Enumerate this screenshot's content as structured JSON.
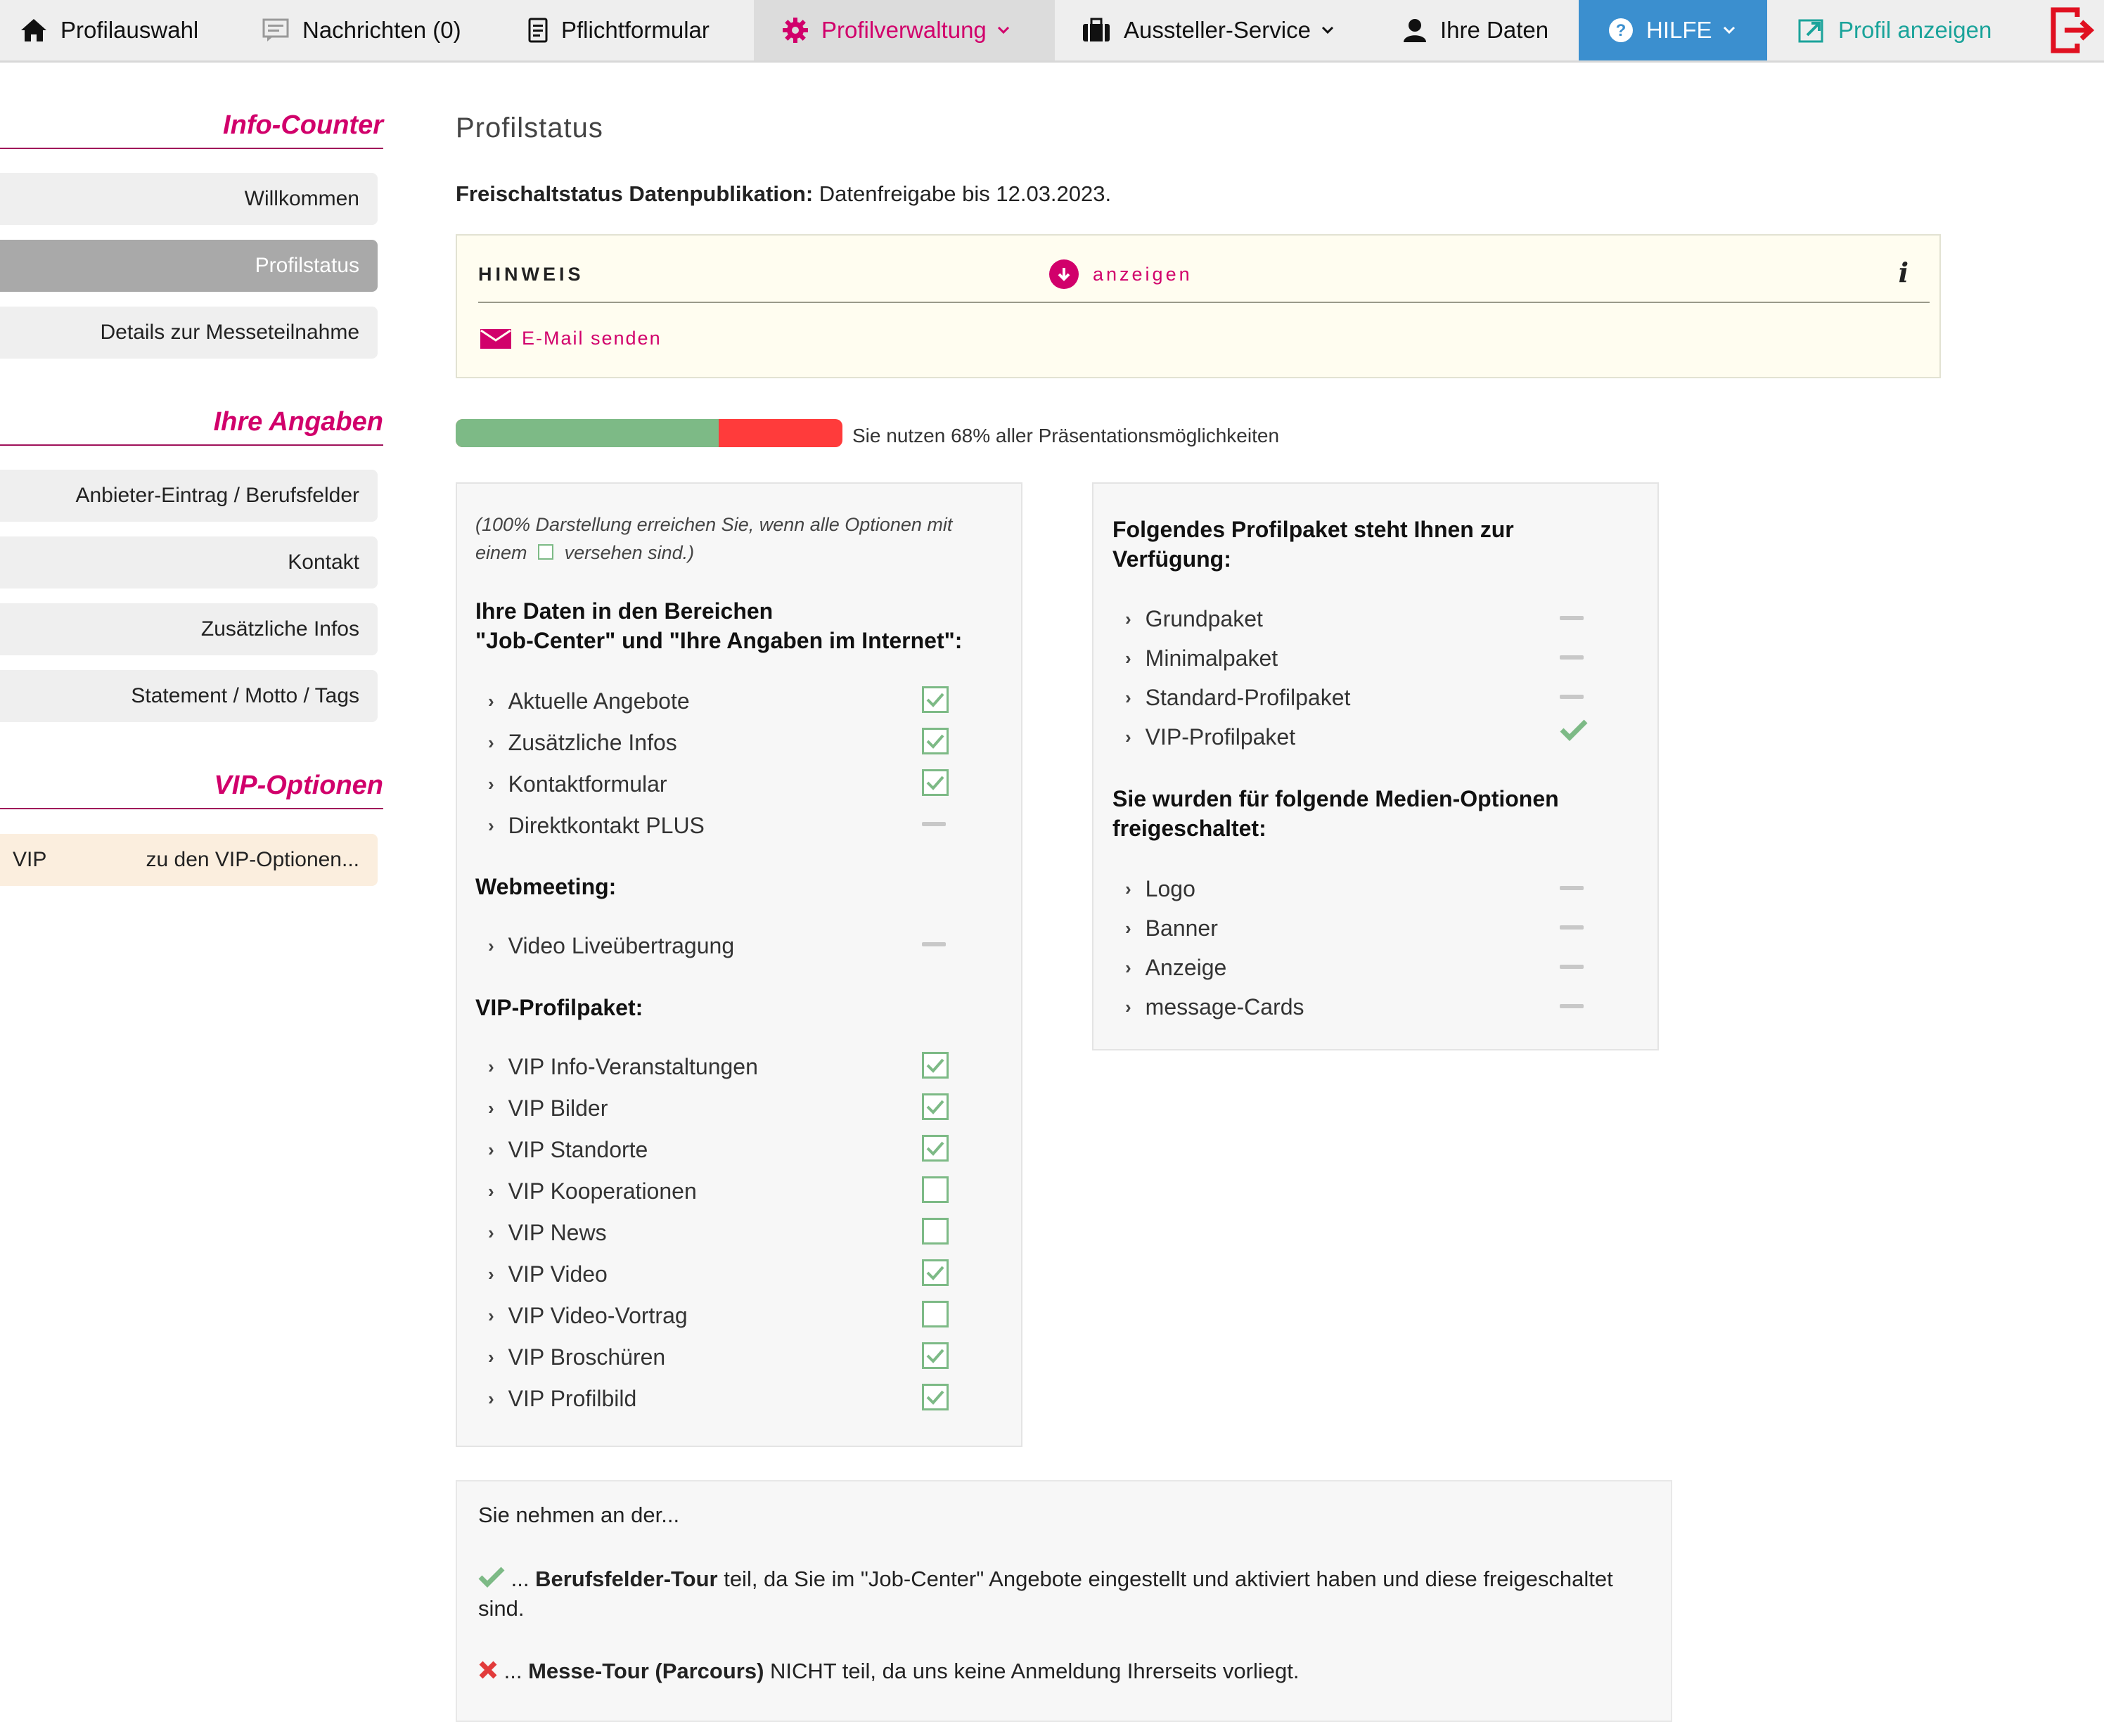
{
  "nav": {
    "profilauswahl": "Profilauswahl",
    "nachrichten": "Nachrichten (0)",
    "pflichtformular": "Pflichtformular",
    "profilverwaltung": "Profilverwaltung",
    "aussteller_service": "Aussteller-Service",
    "ihre_daten": "Ihre Daten",
    "hilfe": "HILFE",
    "profil_anzeigen": "Profil anzeigen"
  },
  "sidebar": {
    "sections": [
      {
        "title": "Info-Counter",
        "items": [
          "Willkommen",
          "Profilstatus",
          "Details zur Messeteilnahme"
        ]
      },
      {
        "title": "Ihre Angaben",
        "items": [
          "Anbieter-Eintrag / Berufsfelder",
          "Kontakt",
          "Zusätzliche Infos",
          "Statement / Motto / Tags"
        ]
      },
      {
        "title": "VIP-Optionen",
        "items": []
      }
    ],
    "vip_tag": "VIP",
    "vip_link": "zu den VIP-Optionen..."
  },
  "main": {
    "title": "Profilstatus",
    "status_label": "Freischaltstatus Datenpublikation:",
    "status_value": " Datenfreigabe bis 12.03.2023.",
    "hinweis": {
      "title": "HINWEIS",
      "show": "anzeigen",
      "info": "i",
      "mail": "E-Mail senden"
    },
    "progress": {
      "percent": 68,
      "text": "Sie nutzen 68% aller Präsentationsmöglichkeiten"
    }
  },
  "left_panel": {
    "note_before": "(100% Darstellung erreichen Sie, wenn alle Optionen mit einem",
    "note_after": "versehen sind.)",
    "section1_title_line1": "Ihre Daten in den Bereichen",
    "section1_title_line2": "\"Job-Center\" und \"Ihre Angaben im Internet\":",
    "section1": [
      {
        "label": "Aktuelle Angebote",
        "status": "checked"
      },
      {
        "label": "Zusätzliche Infos",
        "status": "checked"
      },
      {
        "label": "Kontaktformular",
        "status": "checked"
      },
      {
        "label": "Direktkontakt PLUS",
        "status": "none"
      }
    ],
    "section2_title": "Webmeeting:",
    "section2": [
      {
        "label": "Video Liveübertragung",
        "status": "none"
      }
    ],
    "section3_title": "VIP-Profilpaket:",
    "section3": [
      {
        "label": "VIP Info-Veranstaltungen",
        "status": "checked"
      },
      {
        "label": "VIP Bilder",
        "status": "checked"
      },
      {
        "label": "VIP Standorte",
        "status": "checked"
      },
      {
        "label": "VIP Kooperationen",
        "status": "unchecked"
      },
      {
        "label": "VIP News",
        "status": "unchecked"
      },
      {
        "label": "VIP Video",
        "status": "checked"
      },
      {
        "label": "VIP Video-Vortrag",
        "status": "unchecked"
      },
      {
        "label": "VIP Broschüren",
        "status": "checked"
      },
      {
        "label": "VIP Profilbild",
        "status": "checked"
      }
    ]
  },
  "right_panel": {
    "title_line1": "Folgendes Profilpaket steht Ihnen zur",
    "title_line2": "Verfügung:",
    "pakete": [
      {
        "label": "Grundpaket",
        "status": "none"
      },
      {
        "label": "Minimalpaket",
        "status": "none"
      },
      {
        "label": "Standard-Profilpaket",
        "status": "none"
      },
      {
        "label": "VIP-Profilpaket",
        "status": "tick"
      }
    ],
    "media_title_line1": "Sie wurden für folgende Medien-Optionen",
    "media_title_line2": "freigeschaltet:",
    "media": [
      {
        "label": "Logo",
        "status": "none"
      },
      {
        "label": "Banner",
        "status": "none"
      },
      {
        "label": "Anzeige",
        "status": "none"
      },
      {
        "label": "message-Cards",
        "status": "none"
      }
    ]
  },
  "tour": {
    "title": "Sie nehmen an der...",
    "line1_prefix": " ... ",
    "line1_bold": "Berufsfelder-Tour",
    "line1_rest": " teil, da Sie im \"Job-Center\" Angebote eingestellt und aktiviert haben und diese freigeschaltet sind.",
    "line2_prefix": " ... ",
    "line2_bold": "Messe-Tour (Parcours)",
    "line2_rest": " NICHT teil, da uns keine Anmeldung Ihrerseits vorliegt."
  },
  "colors": {
    "accent": "#d1006b",
    "help_bg": "#3b8fcf",
    "view": "#1aa39a",
    "ok": "#7dba86",
    "bad": "#ff3b3b",
    "cross": "#e23b3b"
  }
}
